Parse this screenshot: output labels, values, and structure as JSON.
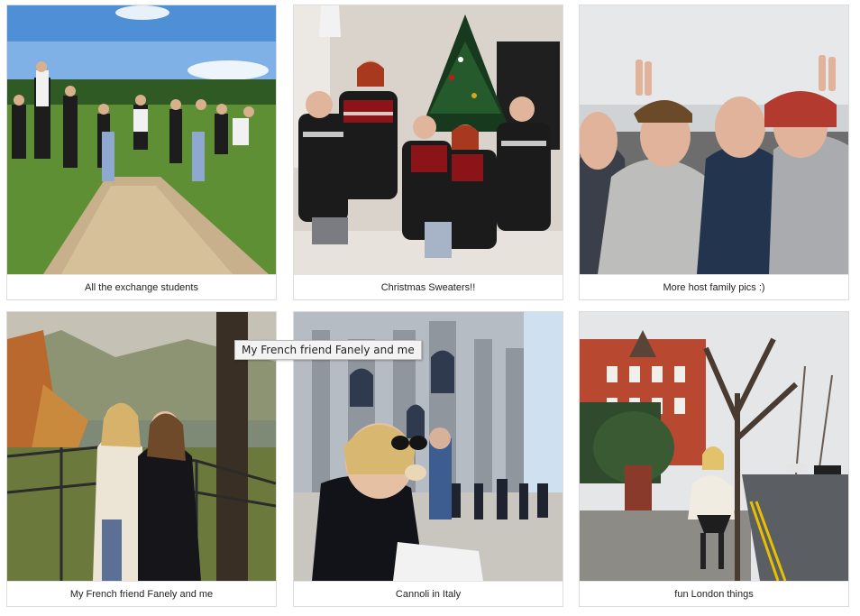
{
  "gallery": {
    "photos": [
      {
        "caption": "All the exchange students"
      },
      {
        "caption": "Christmas Sweaters!!"
      },
      {
        "caption": "More host family pics :)"
      },
      {
        "caption": "My French friend Fanely and me"
      },
      {
        "caption": "Cannoli in Italy"
      },
      {
        "caption": "fun London things"
      }
    ]
  },
  "tooltip": {
    "text": "My French friend Fanely and me"
  }
}
